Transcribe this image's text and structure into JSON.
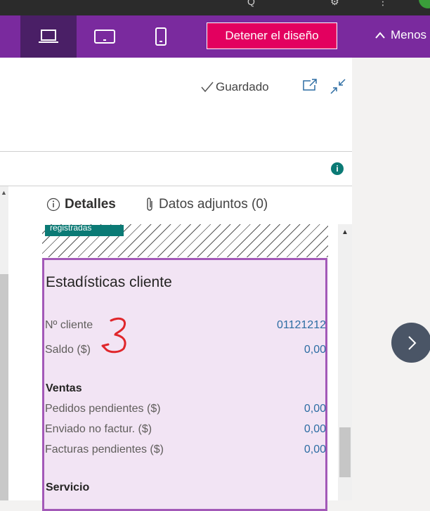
{
  "topbar": {
    "glyphs": [
      "Q",
      "⚙",
      "⋮"
    ]
  },
  "design_bar": {
    "devices": [
      "laptop",
      "tablet",
      "phone"
    ],
    "stop_label": "Detener el diseño",
    "less_label": "Menos",
    "accent": "#7a2a9e",
    "stop_color": "#e3005f"
  },
  "header": {
    "saved_label": "Guardado"
  },
  "info_badge": "i",
  "tabs": [
    {
      "label": "Detalles",
      "icon": "info-icon",
      "active": true
    },
    {
      "label": "Datos adjuntos (0)",
      "icon": "paperclip-icon",
      "active": false
    }
  ],
  "registered_label": "registradas",
  "customer_stats": {
    "title": "Estadísticas cliente",
    "rows": [
      {
        "label": "Nº cliente",
        "value": "01121212"
      },
      {
        "label": "Saldo ($)",
        "value": "0,00"
      }
    ],
    "sales": {
      "header": "Ventas",
      "rows": [
        {
          "label": "Pedidos pendientes ($)",
          "value": "0,00"
        },
        {
          "label": "Enviado no factur. ($)",
          "value": "0,00"
        },
        {
          "label": "Facturas pendientes ($)",
          "value": "0,00"
        }
      ]
    },
    "service": {
      "header": "Servicio"
    }
  }
}
